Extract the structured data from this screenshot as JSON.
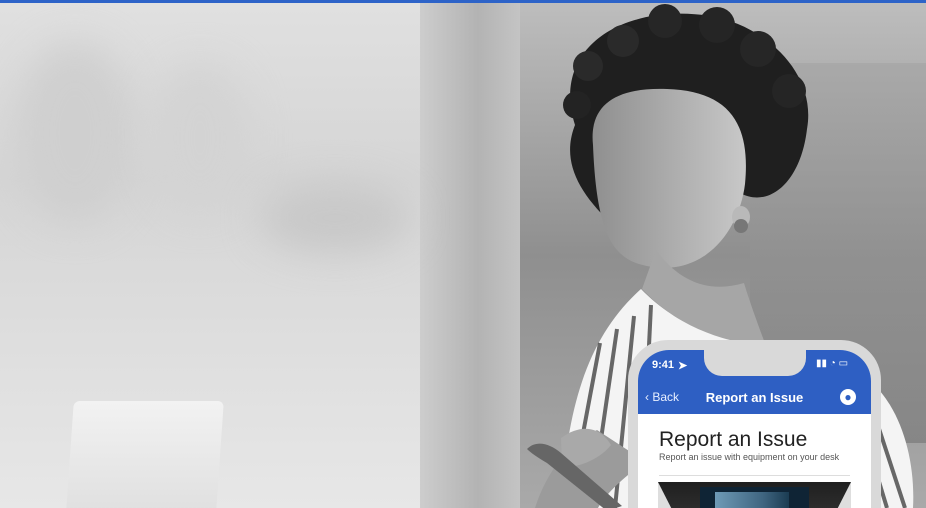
{
  "phone_ui": {
    "status_time": "9:41",
    "nav_back": "Back",
    "nav_title": "Report an Issue",
    "content_title": "Report an Issue",
    "content_subtitle": "Report an issue with equipment on your desk"
  },
  "icons": {
    "location": "location-arrow-icon",
    "back": "chevron-left-icon",
    "profile": "user-circle-icon",
    "status": "signal-wifi-battery-icon"
  },
  "colors": {
    "brand_blue": "#2e5fc3",
    "top_bar": "#2d63c8"
  }
}
